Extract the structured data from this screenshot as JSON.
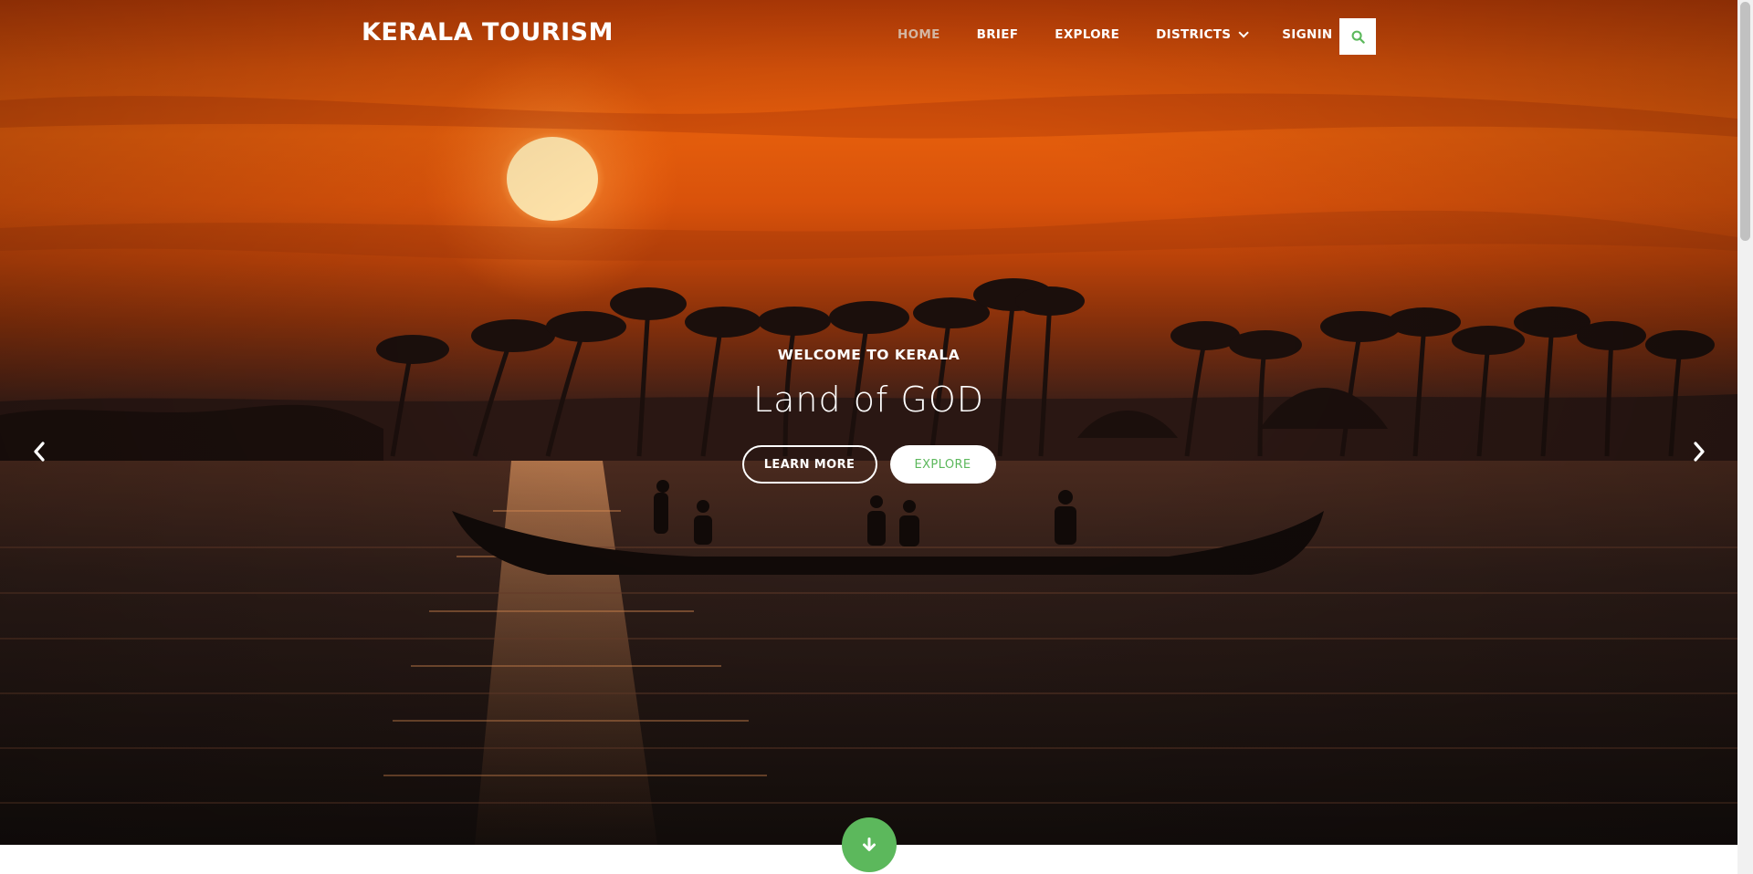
{
  "header": {
    "brand": "KERALA TOURISM",
    "nav": [
      {
        "label": "HOME",
        "active": true
      },
      {
        "label": "BRIEF"
      },
      {
        "label": "EXPLORE"
      },
      {
        "label": "DISTRICTS",
        "has_dropdown": true
      },
      {
        "label": "SIGNIN"
      }
    ],
    "search_icon": "search-icon"
  },
  "hero": {
    "kicker": "WELCOME TO KERALA",
    "headline": "Land of GOD",
    "buttons": {
      "learn_more": "LEARN MORE",
      "explore": "EXPLORE"
    },
    "prev_icon": "chevron-left-icon",
    "next_icon": "chevron-right-icon",
    "scroll_icon": "arrow-down-icon"
  },
  "colors": {
    "accent": "#5cb85c",
    "nav_active": "#d3b6a2",
    "sky": "#e45d0c"
  }
}
